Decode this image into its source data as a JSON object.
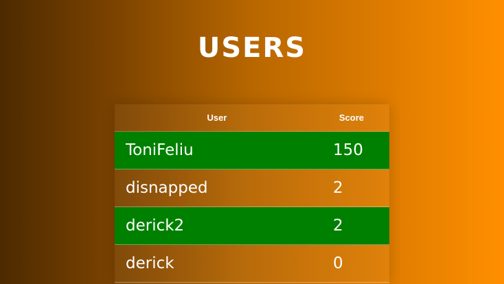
{
  "page": {
    "title": "USERS"
  },
  "table": {
    "headers": {
      "user": "User",
      "score": "Score"
    },
    "rows": [
      {
        "user": "ToniFeliu",
        "score": "150",
        "highlight": true
      },
      {
        "user": "disnapped",
        "score": "2",
        "highlight": false
      },
      {
        "user": "derick2",
        "score": "2",
        "highlight": true
      },
      {
        "user": "derick",
        "score": "0",
        "highlight": false
      }
    ]
  },
  "colors": {
    "highlight_row": "#008000",
    "gradient_start": "#4d2a00",
    "gradient_end": "#ff8f00"
  }
}
